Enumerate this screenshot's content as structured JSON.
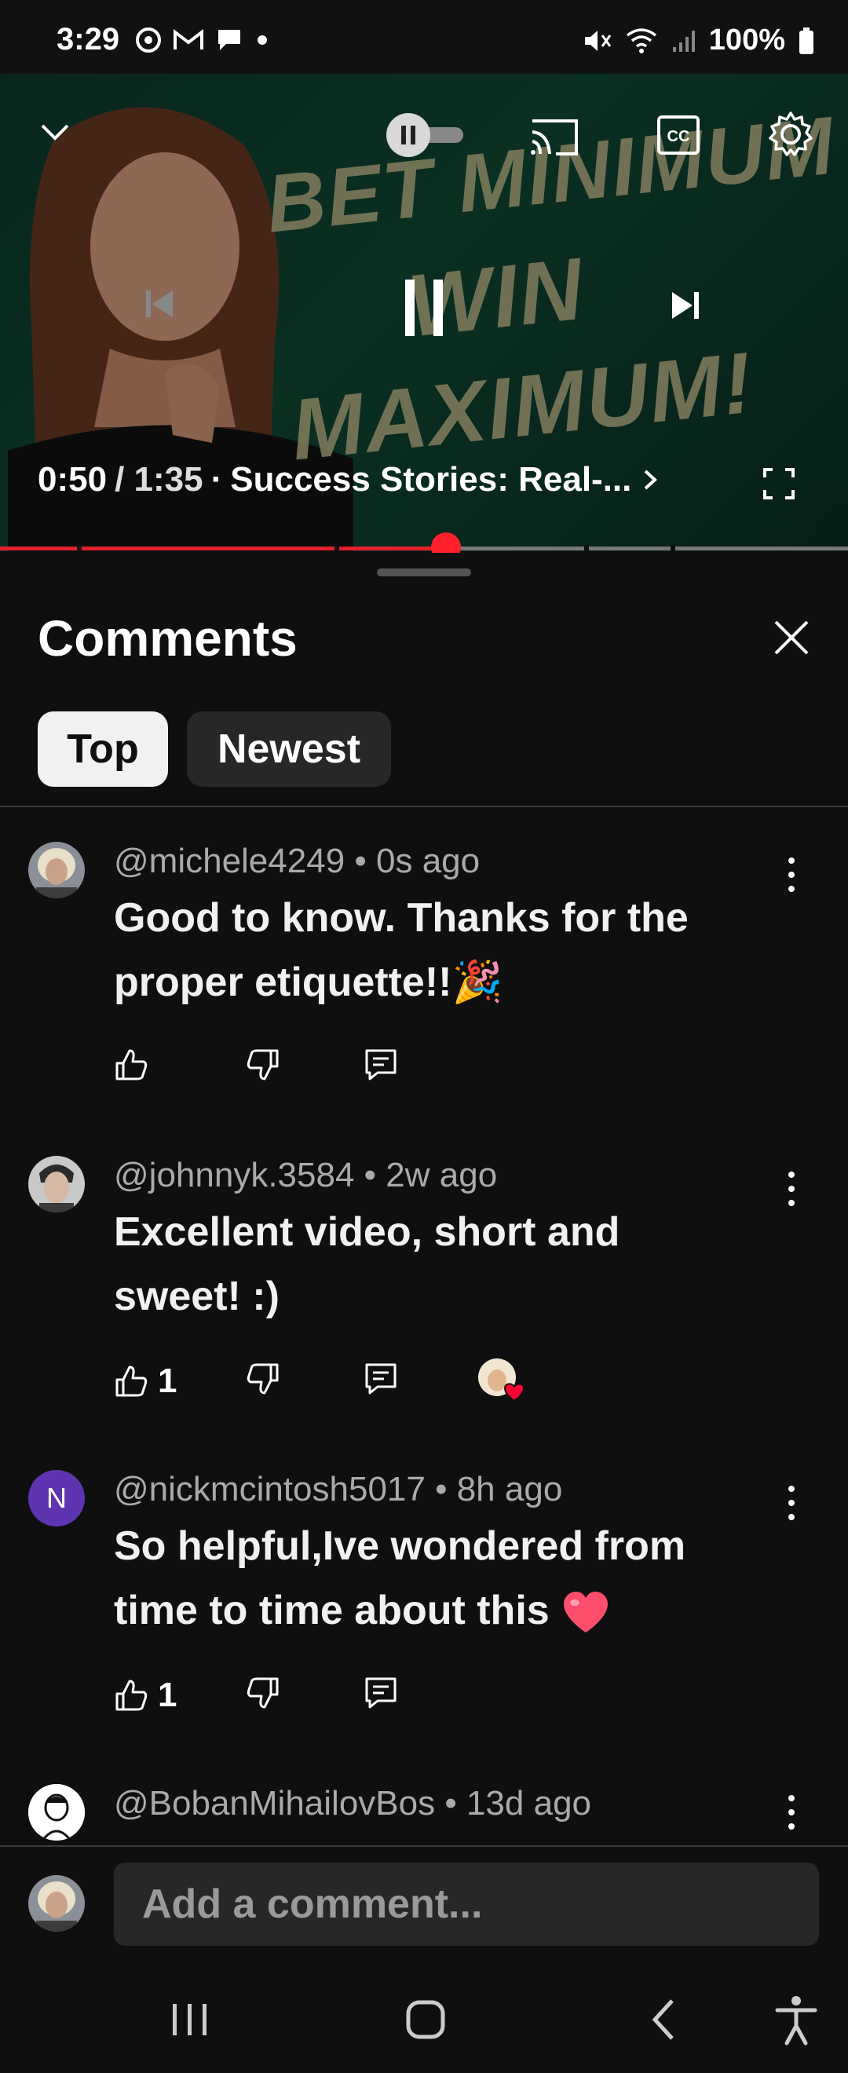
{
  "status_bar": {
    "time": "3:29",
    "battery": "100%"
  },
  "video": {
    "current_time": "0:50",
    "duration": "/ 1:35",
    "separator": "·",
    "chapter_title": "Success Stories: Real-...",
    "thumbnail_text": [
      "BET MINIMUM",
      "WIN",
      "MAXIMUM!"
    ],
    "progress_fraction": 0.526,
    "accent_color": "#e5202b"
  },
  "comments_panel": {
    "title": "Comments",
    "tabs": [
      {
        "label": "Top",
        "selected": true
      },
      {
        "label": "Newest",
        "selected": false
      }
    ],
    "comments": [
      {
        "meta": "@michele4249 • 0s ago",
        "text": "Good to know.  Thanks for the proper etiquette!!🎉",
        "likes": "",
        "creator_heart": false
      },
      {
        "meta": "@johnnyk.3584 • 2w ago",
        "text": "Excellent video, short and sweet! :)",
        "likes": "1",
        "creator_heart": true
      },
      {
        "meta": "@nickmcintosh5017 • 8h ago",
        "text": "So helpful,Ive wondered from time to time about this",
        "emoji": "heart",
        "likes": "1",
        "creator_heart": false,
        "avatar_letter": "N",
        "avatar_color": "#5e35b1"
      },
      {
        "meta": "@BobanMihailovBos • 13d ago",
        "text": "",
        "likes": "",
        "creator_heart": false
      }
    ],
    "composer_placeholder": "Add a comment..."
  }
}
